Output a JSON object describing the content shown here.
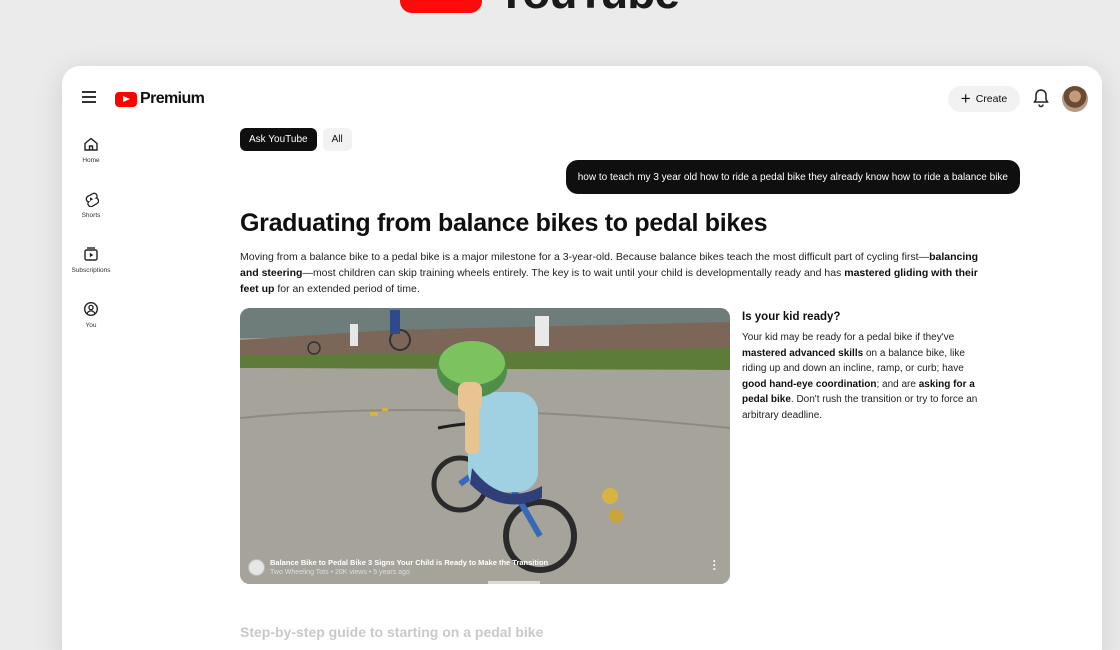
{
  "brand": {
    "name": "YouTube",
    "accent": "#ff0000"
  },
  "header": {
    "logo_text": "Premium",
    "create_label": "Create"
  },
  "sidebar": {
    "items": [
      {
        "label": "Home",
        "icon": "home-icon"
      },
      {
        "label": "Shorts",
        "icon": "shorts-icon"
      },
      {
        "label": "Subscriptions",
        "icon": "subscriptions-icon"
      },
      {
        "label": "You",
        "icon": "you-icon"
      }
    ]
  },
  "chips": [
    "Ask YouTube",
    "All"
  ],
  "query": "how to teach my 3 year old how to ride a pedal bike they already know how to ride a balance bike",
  "answer": {
    "title": "Graduating from balance bikes to pedal bikes",
    "intro": [
      {
        "t": "Moving from a balance bike to a pedal bike is a major milestone for a 3-year-old. Because balance bikes teach the most difficult part of cycling first—",
        "b": false
      },
      {
        "t": "balancing and steering",
        "b": true
      },
      {
        "t": "—most children can skip training wheels entirely. The key is to wait until your child is developmentally ready and has ",
        "b": false
      },
      {
        "t": "mastered gliding with their feet up",
        "b": true
      },
      {
        "t": " for an extended period of time.",
        "b": false
      }
    ],
    "video": {
      "title": "Balance Bike to Pedal Bike 3 Signs Your Child is Ready to Make the Transition",
      "meta": "Two Wheeling Tots • 20K views • 5 years ago"
    },
    "aside_title": "Is your kid ready?",
    "aside": [
      {
        "t": "Your kid may be ready for a pedal bike if they've ",
        "b": false
      },
      {
        "t": "mastered advanced skills",
        "b": true
      },
      {
        "t": " on a balance bike, like riding up and down an incline, ramp, or curb; have ",
        "b": false
      },
      {
        "t": "good hand-eye coordination",
        "b": true
      },
      {
        "t": "; and are ",
        "b": false
      },
      {
        "t": "asking for a pedal bike",
        "b": true
      },
      {
        "t": ". Don't rush the transition or try to force an arbitrary deadline.",
        "b": false
      }
    ],
    "next_section": "Step-by-step guide to starting on a pedal bike"
  }
}
